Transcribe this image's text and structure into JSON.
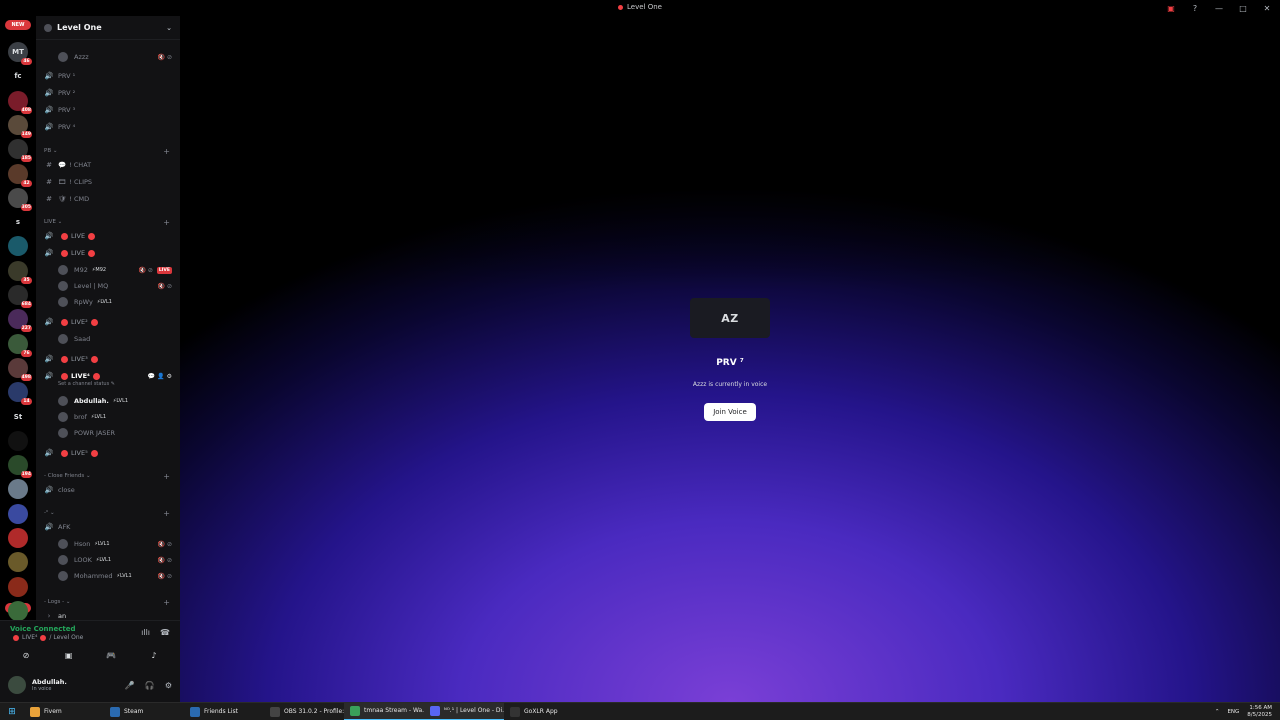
{
  "window": {
    "title": "Level One"
  },
  "rail": {
    "new_top": "NEW",
    "new_bottom": "NEW",
    "servers": [
      {
        "label": "MT",
        "badge": "46",
        "color": "#3b3f45"
      },
      {
        "label": "fc",
        "badge": "",
        "color": "#000000"
      },
      {
        "label": "",
        "badge": "408",
        "color": "#7a1c2a"
      },
      {
        "label": "",
        "badge": "149",
        "color": "#5a4a3a"
      },
      {
        "label": "",
        "badge": "185",
        "color": "#303030"
      },
      {
        "label": "",
        "badge": "42",
        "color": "#5a3a2a"
      },
      {
        "label": "",
        "badge": "305",
        "color": "#4a4a4a"
      },
      {
        "label": "s",
        "badge": "",
        "color": "#000000"
      },
      {
        "label": "",
        "badge": "",
        "color": "#1a5a6a"
      },
      {
        "label": "",
        "badge": "35",
        "color": "#3a3a2a"
      },
      {
        "label": "",
        "badge": "684",
        "color": "#2a2a2a"
      },
      {
        "label": "",
        "badge": "227",
        "color": "#4a2a5a"
      },
      {
        "label": "",
        "badge": "76",
        "color": "#3a5a3a"
      },
      {
        "label": "",
        "badge": "498",
        "color": "#5a3a3a"
      },
      {
        "label": "",
        "badge": "14",
        "color": "#2a3a6a"
      },
      {
        "label": "St",
        "badge": "",
        "color": "#000000"
      },
      {
        "label": "",
        "badge": "",
        "color": "#111111"
      },
      {
        "label": "",
        "badge": "194",
        "color": "#2a4a2a"
      },
      {
        "label": "",
        "badge": "",
        "color": "#6a7a8a"
      },
      {
        "label": "",
        "badge": "",
        "color": "#3a4aa0"
      },
      {
        "label": "",
        "badge": "",
        "color": "#b02a2a"
      },
      {
        "label": "",
        "badge": "",
        "color": "#6a5a2a"
      },
      {
        "label": "",
        "badge": "",
        "color": "#8a2a1a"
      },
      {
        "label": "",
        "badge": "",
        "color": "#3a6a3a"
      }
    ]
  },
  "sidebar": {
    "server_name": "Level One",
    "rows": [
      {
        "kind": "user",
        "name": "Azzz",
        "tag": "",
        "right": "🔇 ⊘"
      },
      {
        "kind": "voice",
        "name": "PRV ¹"
      },
      {
        "kind": "voice",
        "name": "PRV ²"
      },
      {
        "kind": "voice",
        "name": "PRV ³"
      },
      {
        "kind": "voice",
        "name": "PRV ⁴"
      },
      {
        "kind": "cat",
        "name": "PB ⌄"
      },
      {
        "kind": "text",
        "name": "! CHAT",
        "emoji": "💬"
      },
      {
        "kind": "text",
        "name": "! CLIPS",
        "emoji": "🎞"
      },
      {
        "kind": "text",
        "name": "! CMD",
        "emoji": "🛡"
      },
      {
        "kind": "cat",
        "name": "LIVE ⌄"
      },
      {
        "kind": "live",
        "name": "LIVE"
      },
      {
        "kind": "live",
        "name": "LIVE"
      },
      {
        "kind": "user",
        "name": "M92",
        "tag": "⚡M92",
        "right": "🔇 ⊘",
        "live": "LIVE"
      },
      {
        "kind": "user",
        "name": "Level | MQ",
        "tag": "",
        "right": "🔇 ⊘"
      },
      {
        "kind": "user",
        "name": "RpWy",
        "tag": "⚡LVL1",
        "right": ""
      },
      {
        "kind": "live",
        "name": "LIVE²"
      },
      {
        "kind": "user",
        "name": "Saad",
        "tag": "",
        "right": ""
      },
      {
        "kind": "live",
        "name": "LIVE³"
      },
      {
        "kind": "live-active",
        "name": "LIVE⁴",
        "right": "💬 👤 ⚙"
      },
      {
        "kind": "sub",
        "name": "Set a channel status ✎"
      },
      {
        "kind": "user-bold",
        "name": "Abdullah.",
        "tag": "⚡LVL1",
        "right": ""
      },
      {
        "kind": "user",
        "name": "brof",
        "tag": "⚡LVL1",
        "right": ""
      },
      {
        "kind": "user",
        "name": "POWR JASER",
        "tag": "",
        "right": ""
      },
      {
        "kind": "live",
        "name": "LIVE⁵"
      },
      {
        "kind": "cat",
        "name": "- Close Friends ⌄"
      },
      {
        "kind": "voice",
        "name": "close"
      },
      {
        "kind": "cat",
        "name": "-ᵕ̈ ⌄"
      },
      {
        "kind": "voice",
        "name": "AFK"
      },
      {
        "kind": "user",
        "name": "Hson",
        "tag": "⚡LVL1",
        "right": "🔇 ⊘"
      },
      {
        "kind": "user",
        "name": "LOOK",
        "tag": "⚡LVL1",
        "right": "🔇 ⊘"
      },
      {
        "kind": "user",
        "name": "Mohammed",
        "tag": "⚡LVL1",
        "right": "🔇 ⊘"
      },
      {
        "kind": "cat",
        "name": "- Logs - ⌄"
      },
      {
        "kind": "thread",
        "name": "an"
      }
    ]
  },
  "voice_panel": {
    "status": "Voice Connected",
    "channel_prefix": "LIVE⁴",
    "channel_suffix": "/ Level One",
    "user_name": "Abdullah.",
    "user_status": "In voice"
  },
  "main": {
    "card_label": "AZ",
    "channel_name": "PRV ⁷",
    "message": "Azzz is currently in voice",
    "join_label": "Join Voice"
  },
  "taskbar": {
    "items": [
      {
        "label": "Fivem",
        "color": "#e8a23a",
        "active": false
      },
      {
        "label": "Steam",
        "color": "#2a6ab0",
        "active": false
      },
      {
        "label": "Friends List",
        "color": "#2a6ab0",
        "active": false
      },
      {
        "label": "OBS 31.0.2 - Profile:...",
        "color": "#444444",
        "active": false
      },
      {
        "label": "tmnaa Stream - Wa...",
        "color": "#3aa05a",
        "active": true
      },
      {
        "label": "ᴺᴼ.¹ | Level One - Di...",
        "color": "#5865f2",
        "active": true
      },
      {
        "label": "GoXLR App",
        "color": "#333333",
        "active": false
      }
    ],
    "lang": "ENG",
    "time": "1:56 AM",
    "date": "8/5/2025"
  }
}
